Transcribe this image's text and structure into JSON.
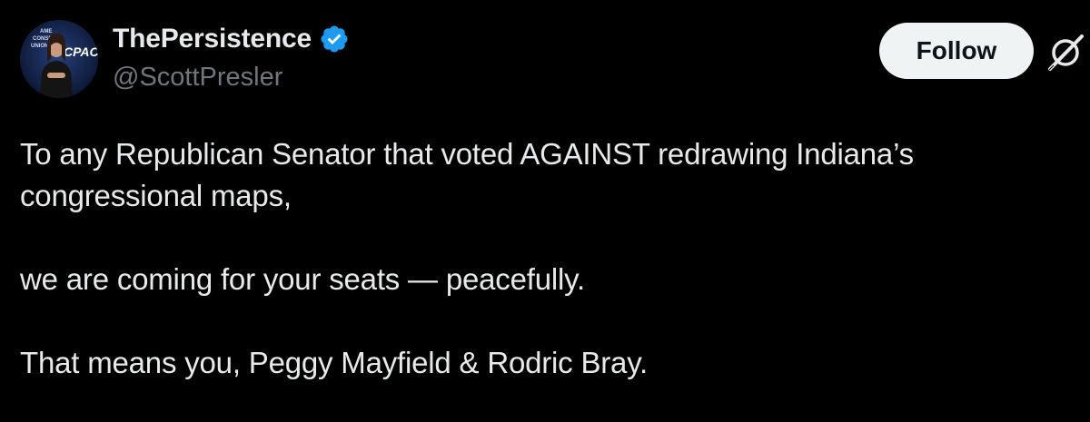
{
  "author": {
    "display_name": "ThePersistence",
    "handle": "@ScottPresler",
    "verified": true,
    "avatar_text": [
      "AME",
      "CONSE",
      "UNION",
      "CPAC"
    ]
  },
  "actions": {
    "follow_label": "Follow"
  },
  "tweet": {
    "paragraphs": [
      "To any Republican Senator that voted AGAINST redrawing Indiana’s congressional maps,",
      "we are coming for your seats — peacefully.",
      "That means you, Peggy Mayfield & Rodric Bray."
    ]
  },
  "colors": {
    "background": "#000000",
    "text": "#e7e9ea",
    "secondary_text": "#71767b",
    "verified_badge": "#1d9bf0",
    "follow_button_bg": "#eff3f4"
  },
  "icons": {
    "verified": "verified-badge-icon",
    "brand": "x-logo-icon"
  }
}
